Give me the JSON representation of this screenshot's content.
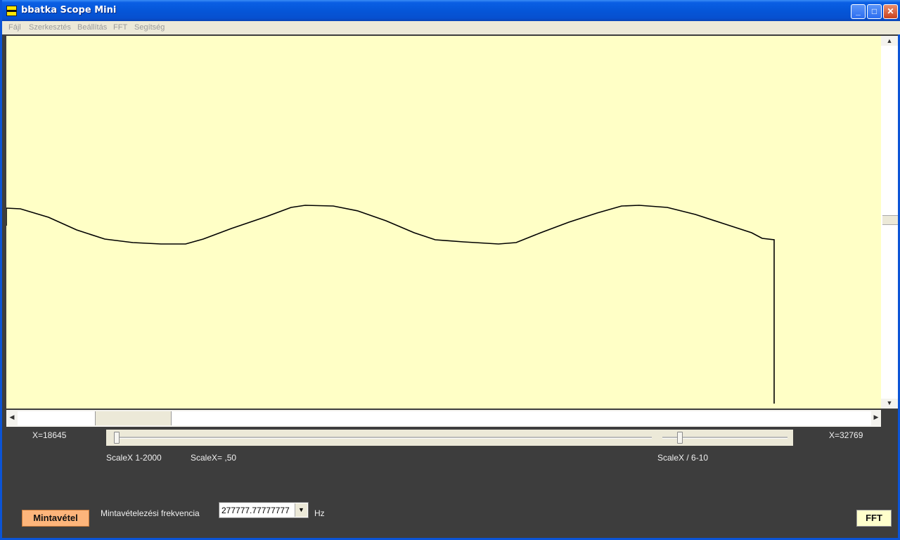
{
  "window": {
    "title": "bbatka Scope Mini"
  },
  "menu": {
    "items": [
      "Fájl",
      "Szerkesztés",
      "Beállítás",
      "FFT",
      "Segítség"
    ]
  },
  "scale": {
    "x_left": "X=18645",
    "x_right": "X=32769",
    "scalex_range": "ScaleX 1-2000",
    "scalex_value": "ScaleX= ,50",
    "scalex_div": "ScaleX / 6-10"
  },
  "controls": {
    "sample_button": "Mintavétel",
    "freq_label": "Mintavételezési frekvencia",
    "freq_value": "277777.77777777",
    "freq_unit": "Hz",
    "fft_button": "FFT"
  },
  "colors": {
    "plot_bg": "#ffffc6",
    "trace": "#000000",
    "sample_button": "#fdb57b",
    "titlebar": "#0556d8"
  },
  "icons": {
    "app": "scope-icon",
    "minimize": "minimize-icon",
    "maximize": "maximize-icon",
    "close": "close-icon",
    "scroll_up": "arrow-up-icon",
    "scroll_down": "arrow-down-icon",
    "scroll_left": "arrow-left-icon",
    "scroll_right": "arrow-right-icon",
    "dropdown": "chevron-down-icon"
  }
}
